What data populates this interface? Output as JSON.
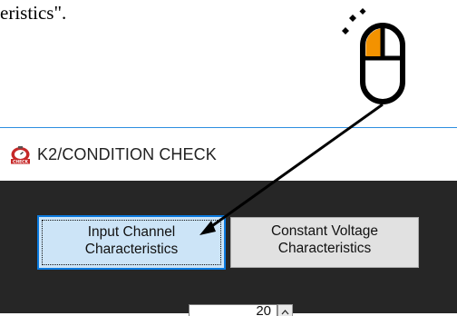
{
  "document": {
    "visible_text": "eristics\"."
  },
  "window": {
    "title": "K2/CONDITION CHECK",
    "icon": "stopwatch-check-icon"
  },
  "buttons": {
    "input_channel": {
      "line1": "Input Channel",
      "line2": "Characteristics",
      "state": "focused"
    },
    "constant_voltage": {
      "line1": "Constant Voltage",
      "line2": "Characteristics"
    }
  },
  "numeric_field": {
    "value": "20"
  },
  "annotation": {
    "icon": "mouse-click-icon",
    "accent_color": "#f39200"
  },
  "colors": {
    "client_background": "#262626",
    "active_button_fill": "#cce4f7",
    "active_button_border": "#0a7adf"
  }
}
